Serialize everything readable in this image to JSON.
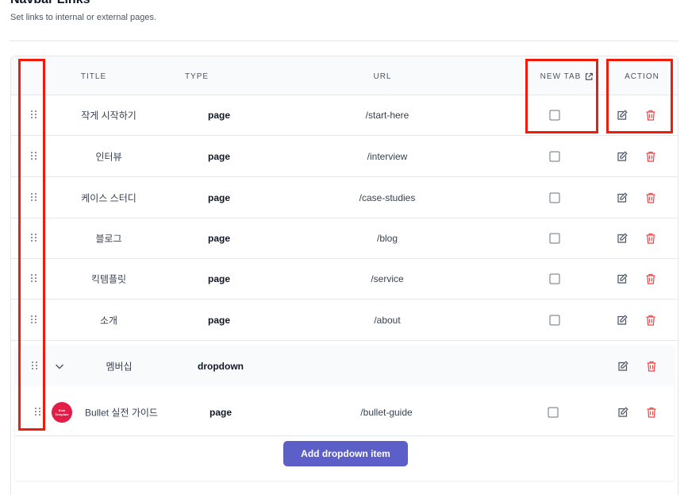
{
  "section": {
    "title": "Navbar Links",
    "description": "Set links to internal or external pages."
  },
  "table": {
    "columns": {
      "title": "TITLE",
      "type": "TYPE",
      "url": "URL",
      "new_tab": "NEW TAB",
      "action": "ACTION"
    },
    "rows": [
      {
        "title": "작게 시작하기",
        "type": "page",
        "url": "/start-here",
        "new_tab": false
      },
      {
        "title": "인터뷰",
        "type": "page",
        "url": "/interview",
        "new_tab": false
      },
      {
        "title": "케이스 스터디",
        "type": "page",
        "url": "/case-studies",
        "new_tab": false
      },
      {
        "title": "블로그",
        "type": "page",
        "url": "/blog",
        "new_tab": false
      },
      {
        "title": "킥템플릿",
        "type": "page",
        "url": "/service",
        "new_tab": false
      },
      {
        "title": "소개",
        "type": "page",
        "url": "/about",
        "new_tab": false
      }
    ],
    "dropdown": {
      "title": "멤버십",
      "type": "dropdown",
      "children": [
        {
          "title": "Bullet 실전 가이드",
          "type": "page",
          "url": "/bullet-guide",
          "new_tab": false,
          "avatar_text_1": "Kick",
          "avatar_text_2": "Template"
        }
      ],
      "add_button_label": "Add dropdown item"
    }
  },
  "colors": {
    "accent": "#5b5fc7",
    "delete": "#ef4444",
    "highlight": "#ef1c0c",
    "avatar": "#e11d48"
  },
  "icons": {
    "drag": "drag-handle-icon",
    "edit": "pencil-icon",
    "delete": "trash-icon",
    "external": "external-link-icon",
    "expand": "chevron-down-icon"
  }
}
